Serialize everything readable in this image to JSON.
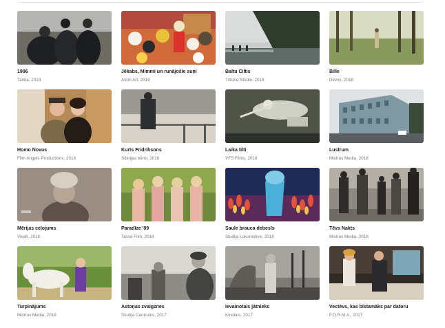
{
  "films": [
    {
      "title": "1906",
      "meta": "Tanka, 2019"
    },
    {
      "title": "Jēkabs, Mimmi un runājošie suņi",
      "meta": "Atom Art, 2019"
    },
    {
      "title": "Baltu Ciltis",
      "meta": "Tritone Studio, 2018"
    },
    {
      "title": "Bille",
      "meta": "Deviņi, 2018"
    },
    {
      "title": "Homo Novus",
      "meta": "Film Angels Productions, 2018"
    },
    {
      "title": "Kurts Fridrihsons",
      "meta": "Sibirijas bērni, 2018"
    },
    {
      "title": "Laika tilti",
      "meta": "VFS Films, 2018"
    },
    {
      "title": "Lustrum",
      "meta": "Mistrus Media, 2018"
    },
    {
      "title": "Mērijas ceļojums",
      "meta": "Vivatī, 2018"
    },
    {
      "title": "Paradīze '89",
      "meta": "Tasse Film, 2018"
    },
    {
      "title": "Saule brauca debesīs",
      "meta": "Studija Lokomotive, 2018"
    },
    {
      "title": "Tēvs Nakts",
      "meta": "Mistrus Media, 2018"
    },
    {
      "title": "Turpinājums",
      "meta": "Mistrus Media, 2018"
    },
    {
      "title": "Astoņas zvaigznes",
      "meta": "Studija Centrums, 2017"
    },
    {
      "title": "Ievainotais jātnieks",
      "meta": "Kinolats, 2017"
    },
    {
      "title": "Vectēvs, kas bīstamāks par datoru",
      "meta": "F.O.R.M.A., 2017"
    }
  ]
}
